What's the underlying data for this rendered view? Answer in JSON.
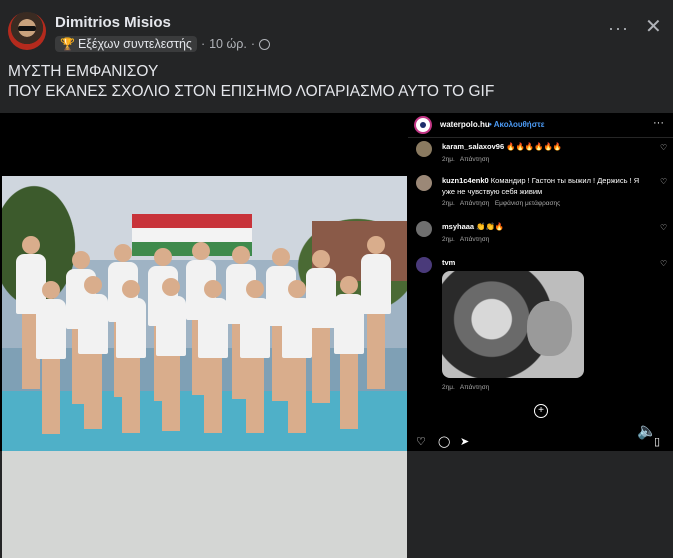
{
  "post": {
    "author": "Dimitrios Misios",
    "badge_label": "Εξέχων συντελεστής",
    "separator": "·",
    "time": "10 ώρ.",
    "text_line1": "ΜΥΣΤΗ ΕΜΦΑΝΙΣΟΥ",
    "text_line2": "ΠΟΥ ΕΚΑΝΕΣ ΣΧΟΛΙΟ ΣΤΟΝ ΕΠΙΣΗΜΟ ΛΟΓΑΡΙΑΣΜΟ ΑΥΤΟ ΤΟ GIF"
  },
  "icons": {
    "more": "···",
    "close": "✕",
    "trophy": "🏆",
    "heart": "♡",
    "add": "+",
    "speaker": "🔈"
  },
  "instagram": {
    "handle": "waterpolo.hu",
    "follow": "• Ακολουθήστε",
    "comments": [
      {
        "user": "karam_salaxov96",
        "text": "🔥🔥🔥🔥🔥🔥",
        "time": "2ημ.",
        "reply": "Απάντηση",
        "translate": ""
      },
      {
        "user": "kuzn1c4enk0",
        "text": "Командир ! Гастон ты выжил ! Держись ! Я уже не чувствую себя живим",
        "time": "2ημ.",
        "reply": "Απάντηση",
        "translate": "Εμφάνιση μετάφρασης"
      },
      {
        "user": "msyhaaa",
        "text": "👏👏🔥",
        "time": "2ημ.",
        "reply": "Απάντηση",
        "translate": ""
      },
      {
        "user": "tvm",
        "text": "",
        "time": "2ημ.",
        "reply": "Απάντηση",
        "translate": ""
      }
    ]
  }
}
